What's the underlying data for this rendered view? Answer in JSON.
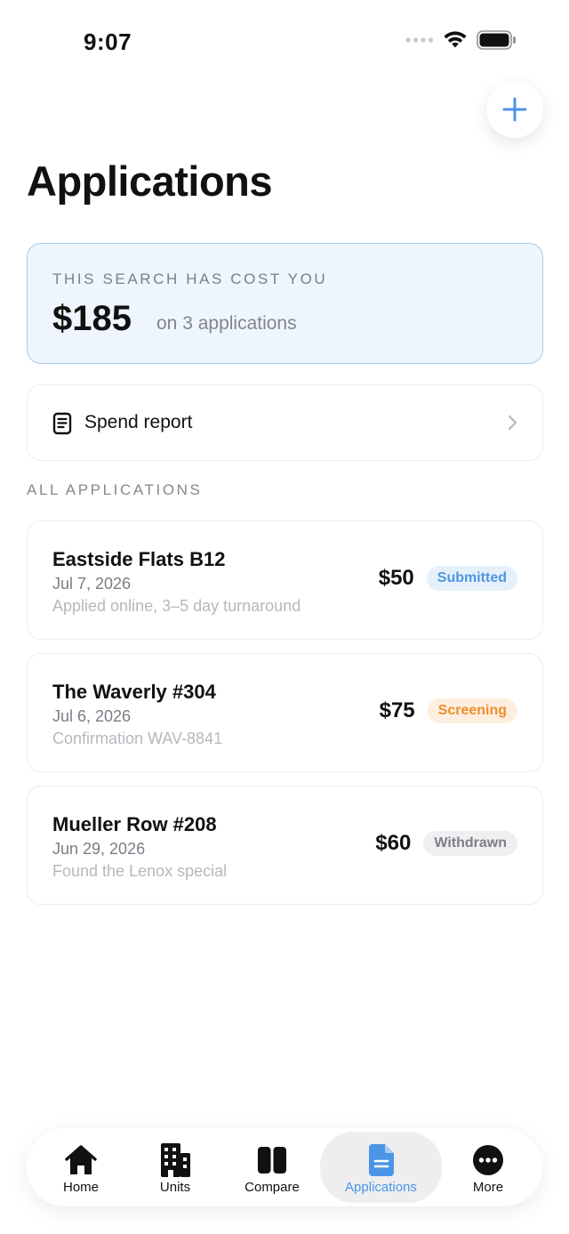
{
  "status_bar": {
    "time": "9:07"
  },
  "header": {
    "title": "Applications",
    "add_icon": "plus-icon"
  },
  "cost_summary": {
    "label": "THIS SEARCH HAS COST YOU",
    "amount": "$185",
    "subtitle": "on 3 applications"
  },
  "spend_report": {
    "label": "Spend report",
    "icon": "document-list-icon"
  },
  "section_label": "ALL APPLICATIONS",
  "applications": [
    {
      "name": "Eastside Flats B12",
      "date": "Jul 7, 2026",
      "note": "Applied online, 3–5 day turnaround",
      "fee": "$50",
      "status": "Submitted"
    },
    {
      "name": "The Waverly #304",
      "date": "Jul 6, 2026",
      "note": "Confirmation WAV-8841",
      "fee": "$75",
      "status": "Screening"
    },
    {
      "name": "Mueller Row #208",
      "date": "Jun 29, 2026",
      "note": "Found the Lenox special",
      "fee": "$60",
      "status": "Withdrawn"
    }
  ],
  "tabs": [
    {
      "label": "Home",
      "icon": "house-icon"
    },
    {
      "label": "Units",
      "icon": "building-icon"
    },
    {
      "label": "Compare",
      "icon": "compare-icon"
    },
    {
      "label": "Applications",
      "icon": "document-icon",
      "active": true
    },
    {
      "label": "More",
      "icon": "ellipsis-circle-icon"
    }
  ],
  "colors": {
    "accent": "#4a95e6",
    "submitted": "#4e97e0",
    "screening": "#ee8e2d",
    "withdrawn": "#7d8087"
  }
}
